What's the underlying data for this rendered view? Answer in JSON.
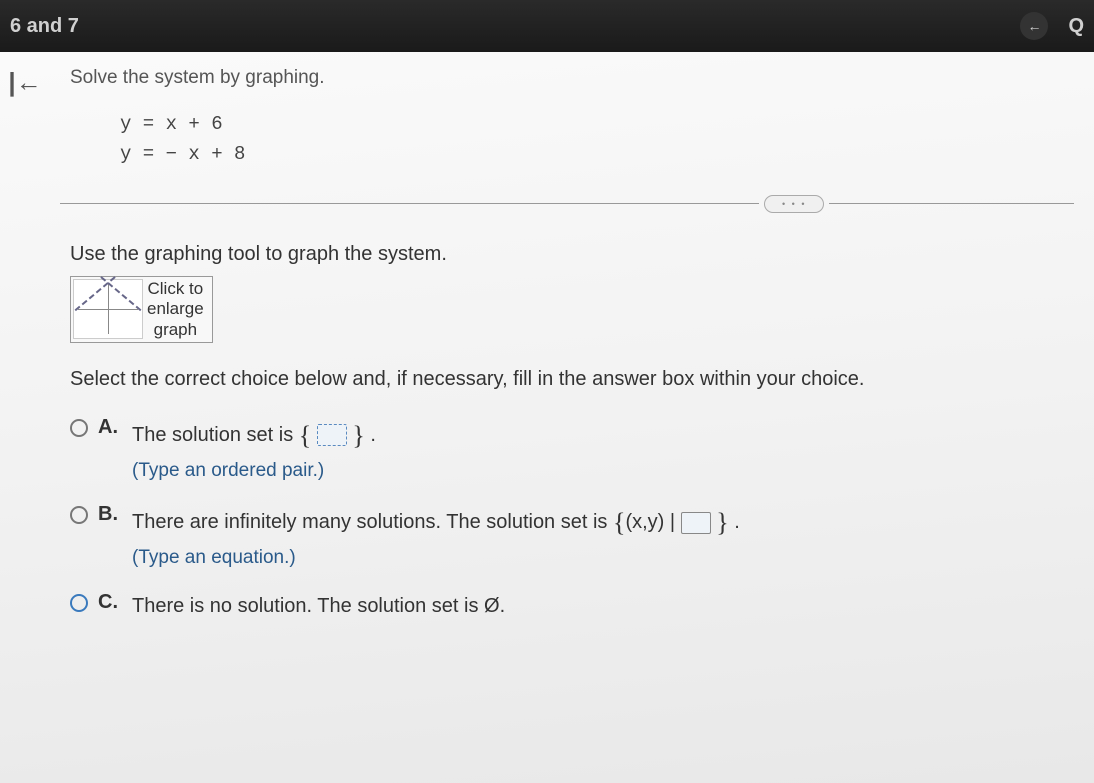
{
  "header": {
    "title": "6 and 7",
    "back_arrow": "←",
    "q_label": "Q"
  },
  "nav": {
    "back_icon": "|←"
  },
  "question": {
    "prompt": "Solve the system by graphing.",
    "eq1": "y  =  x + 6",
    "eq2": "y  =  − x + 8",
    "pill_dots": "• • •",
    "instruction": "Use the graphing tool to graph the system.",
    "graph_button_line1": "Click to",
    "graph_button_line2": "enlarge",
    "graph_button_line3": "graph",
    "select_prompt": "Select the correct choice below and, if necessary, fill in the answer box within your choice."
  },
  "options": {
    "a": {
      "letter": "A.",
      "text_before": "The solution set is ",
      "text_after": " .",
      "hint": "(Type an ordered pair.)"
    },
    "b": {
      "letter": "B.",
      "text_before": "There are infinitely many solutions. The solution set is ",
      "set_prefix": "(x,y) | ",
      "text_after": " .",
      "hint": "(Type an equation.)"
    },
    "c": {
      "letter": "C.",
      "text": "There is no solution. The solution set is Ø."
    }
  }
}
